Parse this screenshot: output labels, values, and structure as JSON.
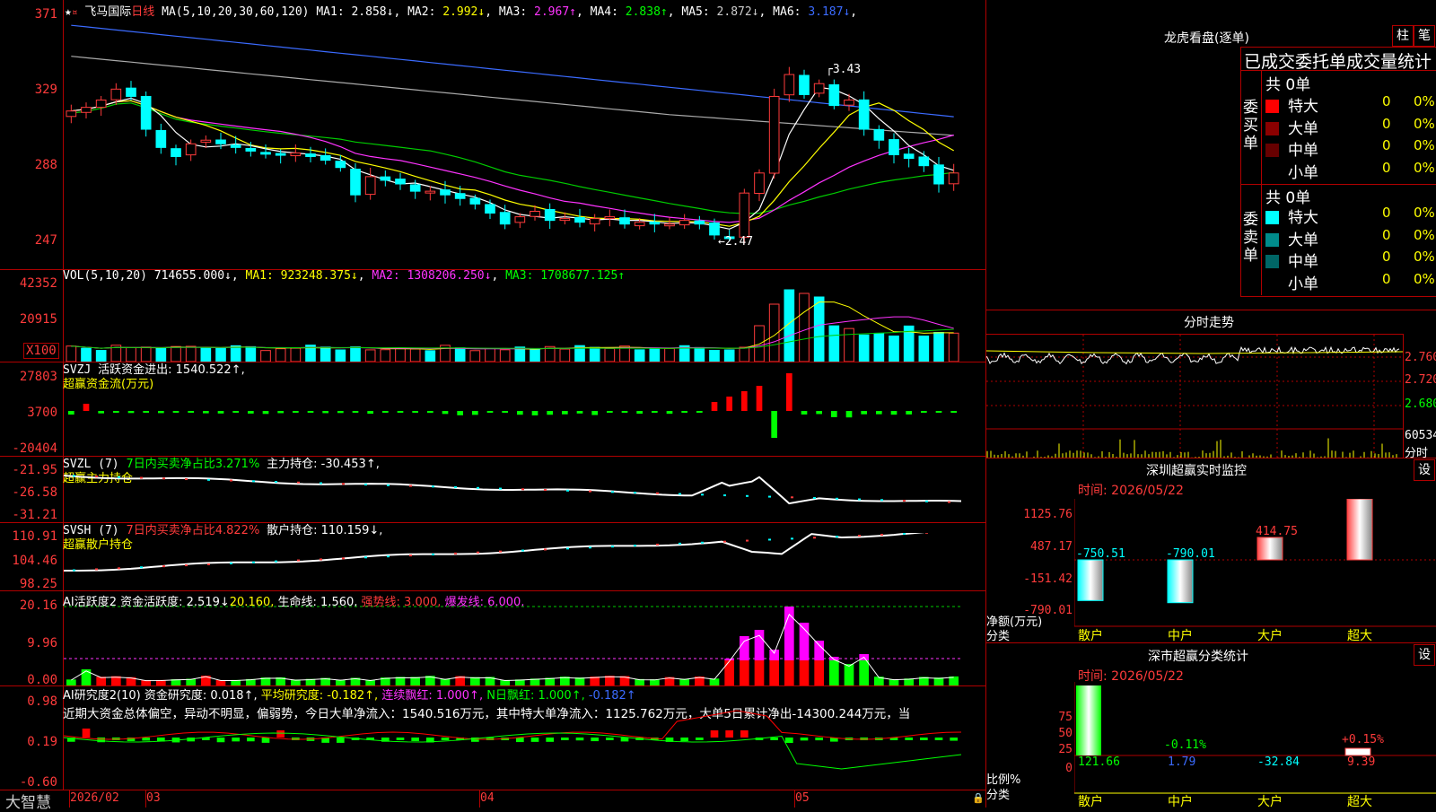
{
  "main": {
    "stock_name": "飞马国际",
    "period": "日线",
    "ma_label": "MA(5,10,20,30,60,120)",
    "ma_values": [
      {
        "label": "MA1:",
        "value": "2.858↓",
        "color": "#ffffff"
      },
      {
        "label": "MA2:",
        "value": "2.992↓",
        "color": "#ffff00"
      },
      {
        "label": "MA3:",
        "value": "2.967↑",
        "color": "#ff33ff"
      },
      {
        "label": "MA4:",
        "value": "2.838↑",
        "color": "#00ff00"
      },
      {
        "label": "MA5:",
        "value": "2.872↓",
        "color": "#cccccc"
      },
      {
        "label": "MA6:",
        "value": "3.187↓",
        "color": "#3b6bff"
      }
    ],
    "y_ticks": [
      "371",
      "329",
      "288",
      "247"
    ],
    "high_mark": "3.43",
    "low_mark": "2.47"
  },
  "vol": {
    "label": "VOL(5,10,20)",
    "value": "714655.000↓",
    "ma1": "MA1: 923248.375↓",
    "ma2": "MA2: 1308206.250↓",
    "ma3": "MA3: 1708677.125↑",
    "y_ticks": [
      "42352",
      "20915"
    ],
    "unit": "X100"
  },
  "svzj": {
    "label": "SVZJ",
    "line1": "活跃资金进出: 1540.522↑,",
    "line2": "超赢资金流(万元)",
    "y_ticks": [
      "27803",
      "3700",
      "-20404"
    ]
  },
  "svzl": {
    "label": "SVZL (7)",
    "pct": "7日内买卖净占比3.271%",
    "hold": "主力持仓: -30.453↑,",
    "line2": "超赢主力持仓",
    "y_ticks": [
      "-21.95",
      "-26.58",
      "-31.21"
    ]
  },
  "svsh": {
    "label": "SVSH (7)",
    "pct": "7日内买卖净占比4.822%",
    "hold": "散户持仓: 110.159↓,",
    "line2": "超赢散户持仓",
    "y_ticks": [
      "110.91",
      "104.46",
      "98.25"
    ]
  },
  "ai1": {
    "label": "AI活跃度2",
    "a": "资金活跃度: 2.519↓",
    "b": "20.160,",
    "c": "生命线: 1.560,",
    "d": "强势线: 3.000,",
    "e": "爆发线: 6.000,",
    "y_ticks": [
      "20.16",
      "9.96",
      "0.00"
    ]
  },
  "ai2": {
    "label": "AI研究度2(10)",
    "a": "资金研究度: 0.018↑,",
    "b": "平均研究度: -0.182↑,",
    "c": "连续飘红: 1.000↑,",
    "d": "N日飘红: 1.000↑,",
    "e": "-0.182↑",
    "comment": "近期大资金总体偏空，异动不明显，偏弱势，今日大单净流入：1540.516万元，其中特大单净流入：1125.762万元，大单5日累计净出-14300.244万元，当",
    "y_ticks": [
      "0.98",
      "0.19",
      "-0.60"
    ]
  },
  "xaxis": {
    "labels": [
      "2026/02",
      "03",
      "04",
      "05"
    ]
  },
  "logo": "大智慧",
  "right": {
    "dragon_title": "龙虎看盘(逐单)",
    "btn_zhu": "柱",
    "btn_bi": "笔",
    "ob_title": "已成交委托单成交量统计",
    "buy_side": "委买单",
    "sell_side": "委卖单",
    "buy_total": "共 0单",
    "sell_total": "共 0单",
    "buy_rows": [
      {
        "name": "特大",
        "count": "0",
        "pct": "0%",
        "color": "#ff0000"
      },
      {
        "name": "大单",
        "count": "0",
        "pct": "0%",
        "color": "#8b0000"
      },
      {
        "name": "中单",
        "count": "0",
        "pct": "0%",
        "color": "#660000"
      },
      {
        "name": "小单",
        "count": "0",
        "pct": "0%",
        "color": "#000000"
      }
    ],
    "sell_rows": [
      {
        "name": "特大",
        "count": "0",
        "pct": "0%",
        "color": "#00ffff"
      },
      {
        "name": "大单",
        "count": "0",
        "pct": "0%",
        "color": "#008b8b"
      },
      {
        "name": "中单",
        "count": "0",
        "pct": "0%",
        "color": "#006666"
      },
      {
        "name": "小单",
        "count": "0",
        "pct": "0%",
        "color": "#000000"
      }
    ],
    "fs_title": "分时走势",
    "fs_ticks": [
      "2.760",
      "2.720",
      "2.680"
    ],
    "fs_vol": "60534",
    "fs_unit": "分时",
    "sz_title": "深圳超赢实时监控",
    "sz_btn": "设",
    "sz_time": "时间: 2026/05/22",
    "sz_ticks": [
      "1125.76",
      "487.17",
      "-151.42",
      "-790.01"
    ],
    "sz_ylabel": "净额(万元)",
    "sz_xlabel": "分类",
    "sz_cats": [
      "散户",
      "中户",
      "大户",
      "超大"
    ],
    "sz_values": [
      "-750.51",
      "-790.01",
      "414.75",
      "1125.76"
    ],
    "fl_title": "深市超赢分类统计",
    "fl_btn": "设",
    "fl_time": "时间: 2026/05/22",
    "fl_ticks": [
      "75",
      "50",
      "25",
      "0"
    ],
    "fl_ylabel": "比例%",
    "fl_xlabel": "分类",
    "fl_cats": [
      "散户",
      "中户",
      "大户",
      "超大"
    ],
    "fl_values": [
      "121.66",
      "1.79",
      "-32.84",
      "9.39"
    ],
    "fl_pcts": [
      "-0.11%",
      "+0.15%"
    ]
  }
}
